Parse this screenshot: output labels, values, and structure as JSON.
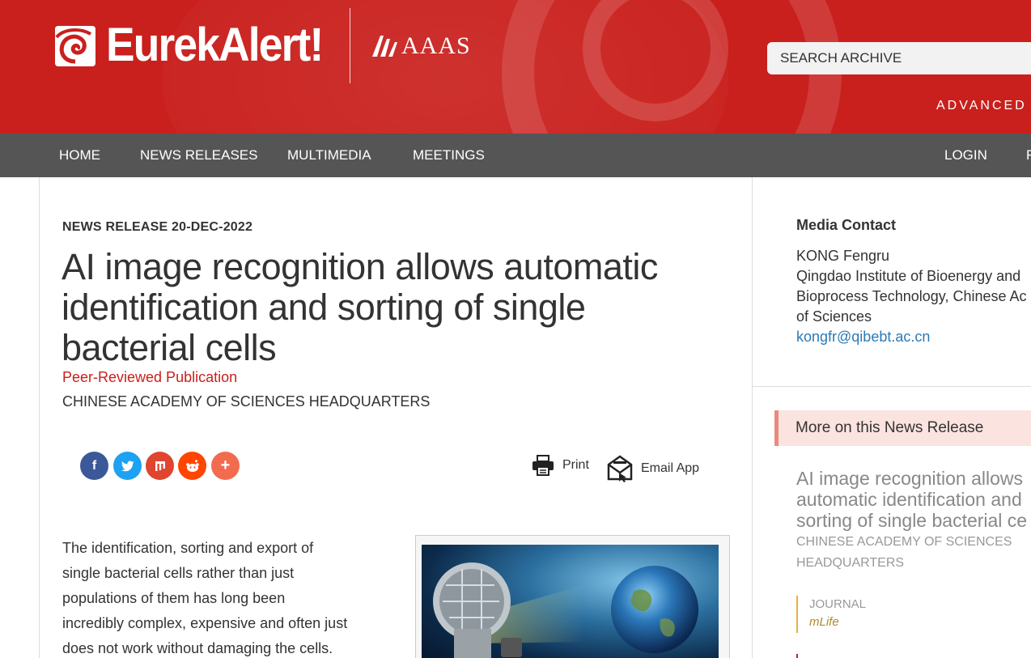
{
  "header": {
    "logo_text": "EurekAlert!",
    "partner_text": "AAAS",
    "search_placeholder": "SEARCH ARCHIVE",
    "advanced_search_label": "ADVANCED S"
  },
  "nav": {
    "items": [
      "HOME",
      "NEWS RELEASES",
      "MULTIMEDIA",
      "MEETINGS"
    ],
    "login": "LOGIN",
    "overflow": "R"
  },
  "article": {
    "kicker": "NEWS RELEASE 20-DEC-2022",
    "title": "AI image recognition allows automatic identification and sorting of single bacterial cells",
    "publication_type": "Peer-Reviewed Publication",
    "organization": "CHINESE ACADEMY OF SCIENCES HEADQUARTERS",
    "body_lines": [
      "The identification, sorting and export of",
      "single bacterial cells rather than just",
      "populations of them has long been",
      "incredibly complex, expensive and often just",
      "does not work without damaging the cells."
    ],
    "share": {
      "facebook": "f",
      "twitter": "t",
      "mix": "m",
      "reddit": "r",
      "more": "+"
    },
    "tools": {
      "print": "Print",
      "email": "Email App"
    }
  },
  "sidebar": {
    "contact_heading": "Media Contact",
    "contact_lines": [
      "KONG Fengru",
      "Qingdao Institute of Bioenergy and",
      "Bioprocess Technology, Chinese Ac",
      "of Sciences"
    ],
    "contact_email": "kongfr@qibebt.ac.cn",
    "more_label": "More on this News Release",
    "related_title_lines": [
      "AI image recognition allows",
      "automatic identification and",
      "sorting of single bacterial ce"
    ],
    "related_org_lines": [
      "CHINESE ACADEMY OF SCIENCES",
      "HEADQUARTERS"
    ],
    "journal_label": "JOURNAL",
    "journal_name": "mLife"
  },
  "colors": {
    "brand_red": "#c9201d",
    "nav_gray": "#555555",
    "link_blue": "#2a7ab8",
    "facebook": "#3b5998",
    "twitter": "#1da1f2",
    "mix": "#e0452f",
    "reddit": "#ff4500",
    "more": "#f26b4f"
  }
}
